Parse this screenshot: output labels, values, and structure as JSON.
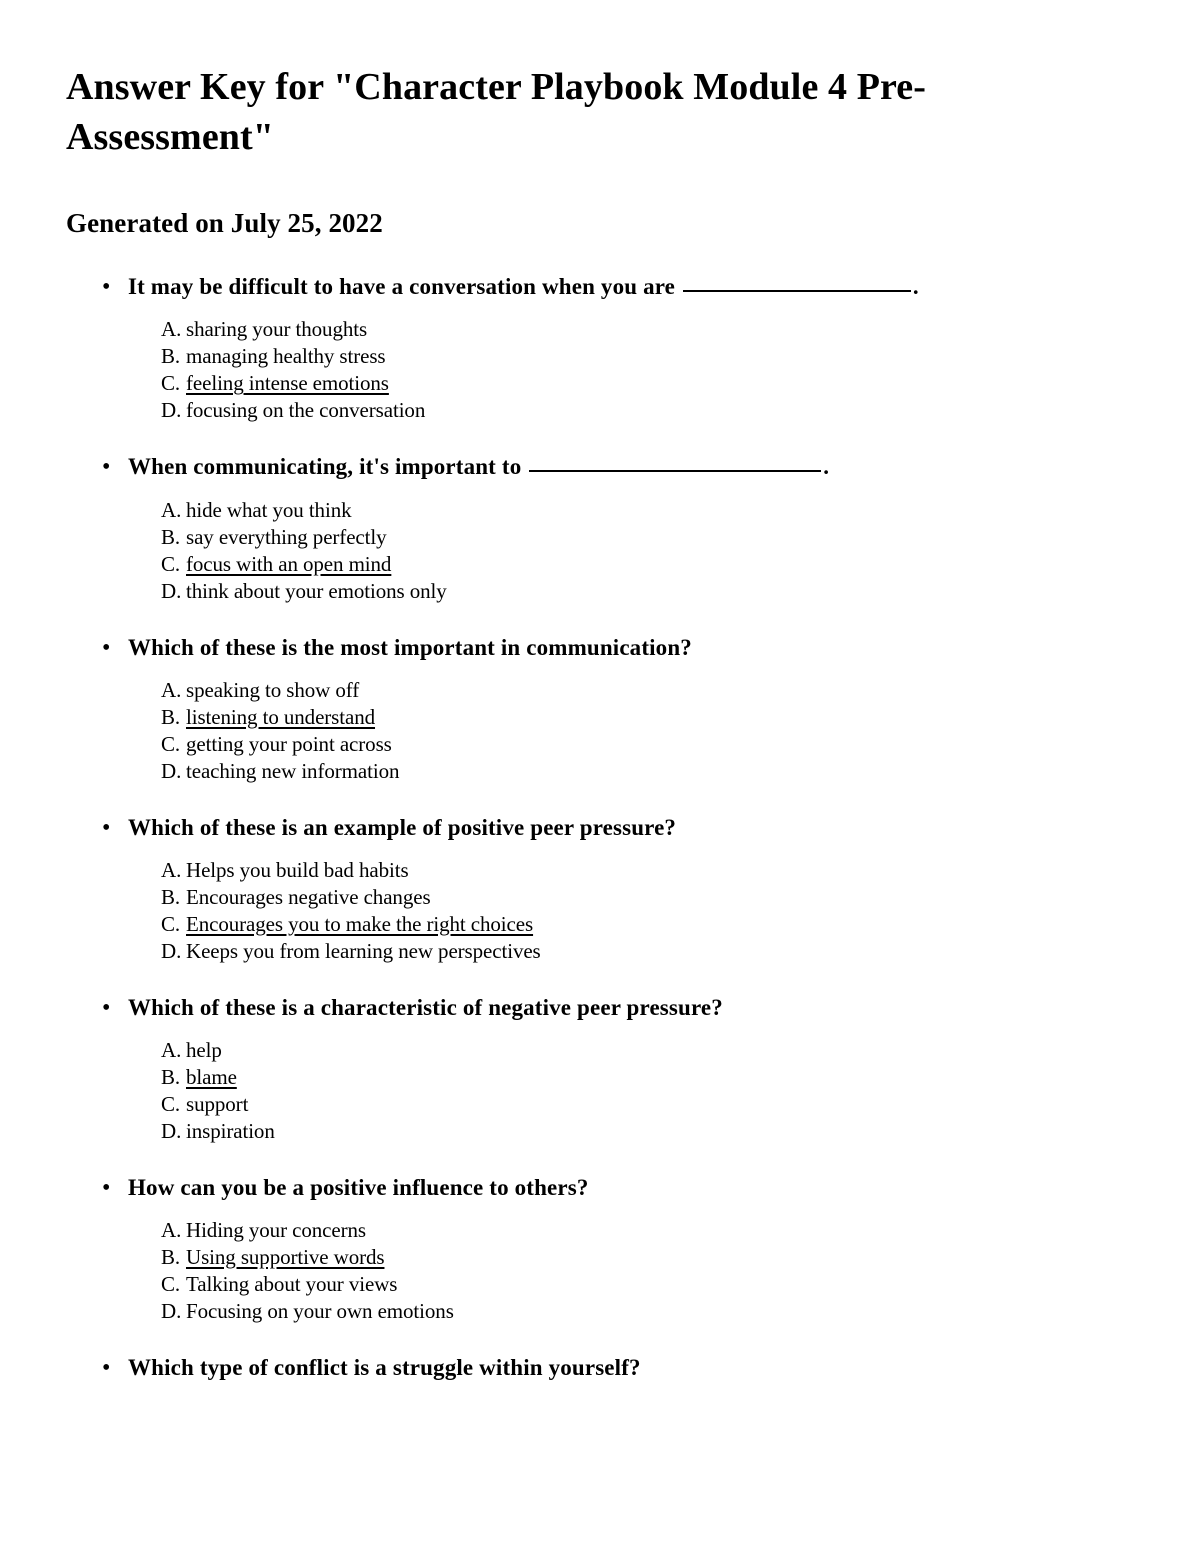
{
  "document": {
    "title": "Answer Key for \"Character Playbook Module 4 Pre-Assessment\"",
    "subtitle": "Generated on July 25, 2022",
    "bullet_glyph": "•",
    "blank_placeholder": "________________"
  },
  "questions": [
    {
      "text_before_blank": "It may be difficult to have a conversation when you are ",
      "has_blank": true,
      "blank_width": "blank-w1",
      "text_after_blank": ".",
      "options": [
        {
          "letter": "A.",
          "text": "sharing your thoughts",
          "correct": false
        },
        {
          "letter": "B.",
          "text": "managing healthy stress",
          "correct": false
        },
        {
          "letter": "C.",
          "text": "feeling intense emotions",
          "correct": true
        },
        {
          "letter": "D.",
          "text": "focusing on the conversation",
          "correct": false
        }
      ]
    },
    {
      "text_before_blank": "When communicating, it's important to ",
      "has_blank": true,
      "blank_width": "blank-w2",
      "text_after_blank": ".",
      "options": [
        {
          "letter": "A.",
          "text": "hide what you think",
          "correct": false
        },
        {
          "letter": "B.",
          "text": "say everything perfectly",
          "correct": false
        },
        {
          "letter": "C.",
          "text": "focus with an open mind",
          "correct": true
        },
        {
          "letter": "D.",
          "text": "think about your emotions only",
          "correct": false
        }
      ]
    },
    {
      "text_before_blank": "Which of these is the most important in communication?",
      "has_blank": false,
      "blank_width": "",
      "text_after_blank": "",
      "options": [
        {
          "letter": "A.",
          "text": "speaking to show off",
          "correct": false
        },
        {
          "letter": "B.",
          "text": "listening to understand",
          "correct": true
        },
        {
          "letter": "C.",
          "text": "getting your point across",
          "correct": false
        },
        {
          "letter": "D.",
          "text": "teaching new information",
          "correct": false
        }
      ]
    },
    {
      "text_before_blank": "Which of these is an example of positive peer pressure?",
      "has_blank": false,
      "blank_width": "",
      "text_after_blank": "",
      "options": [
        {
          "letter": "A.",
          "text": "Helps you build bad habits",
          "correct": false
        },
        {
          "letter": "B.",
          "text": "Encourages negative changes",
          "correct": false
        },
        {
          "letter": "C.",
          "text": "Encourages you to make the right choices",
          "correct": true
        },
        {
          "letter": "D.",
          "text": "Keeps you from learning new perspectives",
          "correct": false
        }
      ]
    },
    {
      "text_before_blank": "Which of these is a characteristic of negative peer pressure?",
      "has_blank": false,
      "blank_width": "",
      "text_after_blank": "",
      "options": [
        {
          "letter": "A.",
          "text": "help",
          "correct": false
        },
        {
          "letter": "B.",
          "text": "blame",
          "correct": true
        },
        {
          "letter": "C.",
          "text": "support",
          "correct": false
        },
        {
          "letter": "D.",
          "text": "inspiration",
          "correct": false
        }
      ]
    },
    {
      "text_before_blank": "How can you be a positive influence to others?",
      "has_blank": false,
      "blank_width": "",
      "text_after_blank": "",
      "options": [
        {
          "letter": "A.",
          "text": "Hiding your concerns",
          "correct": false
        },
        {
          "letter": "B.",
          "text": "Using supportive words",
          "correct": true
        },
        {
          "letter": "C.",
          "text": "Talking about your views",
          "correct": false
        },
        {
          "letter": "D.",
          "text": "Focusing on your own emotions",
          "correct": false
        }
      ]
    },
    {
      "text_before_blank": "Which type of conflict is a struggle within yourself?",
      "has_blank": false,
      "blank_width": "",
      "text_after_blank": "",
      "options": []
    }
  ]
}
